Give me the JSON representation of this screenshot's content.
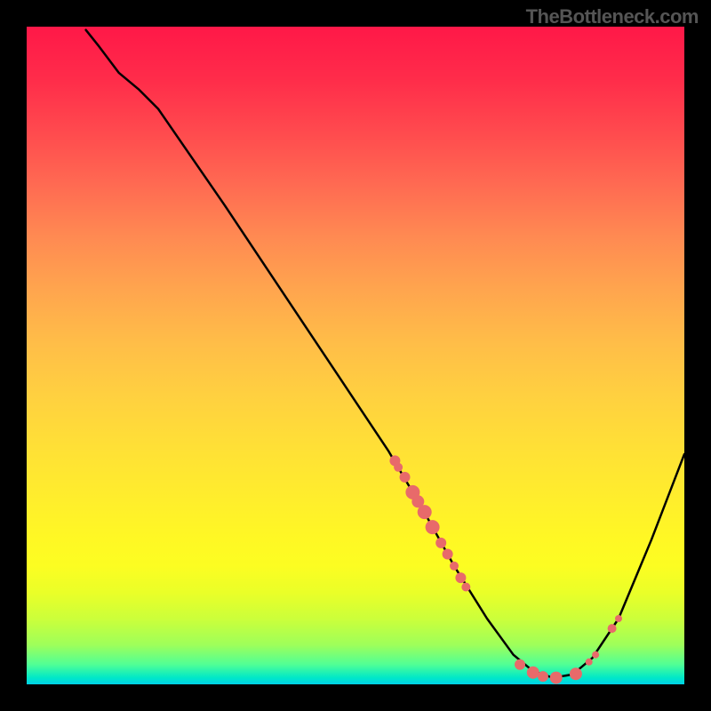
{
  "watermark": "TheBottleneck.com",
  "chart_data": {
    "type": "line",
    "title": "",
    "xlabel": "",
    "ylabel": "",
    "xlim": [
      0,
      100
    ],
    "ylim": [
      0,
      100
    ],
    "curve": [
      {
        "x": 9.0,
        "y": 99.5
      },
      {
        "x": 11.0,
        "y": 97.0
      },
      {
        "x": 14.0,
        "y": 93.0
      },
      {
        "x": 17.0,
        "y": 90.5
      },
      {
        "x": 20.0,
        "y": 87.5
      },
      {
        "x": 30.0,
        "y": 73.0
      },
      {
        "x": 40.0,
        "y": 58.0
      },
      {
        "x": 50.0,
        "y": 43.0
      },
      {
        "x": 55.0,
        "y": 35.5
      },
      {
        "x": 60.0,
        "y": 27.0
      },
      {
        "x": 65.0,
        "y": 18.0
      },
      {
        "x": 70.0,
        "y": 10.0
      },
      {
        "x": 74.0,
        "y": 4.5
      },
      {
        "x": 77.0,
        "y": 2.0
      },
      {
        "x": 80.0,
        "y": 1.0
      },
      {
        "x": 83.0,
        "y": 1.5
      },
      {
        "x": 86.0,
        "y": 4.0
      },
      {
        "x": 90.0,
        "y": 10.0
      },
      {
        "x": 95.0,
        "y": 22.0
      },
      {
        "x": 100.0,
        "y": 35.0
      }
    ],
    "highlight_dots": [
      {
        "x": 56.0,
        "y": 34.0,
        "r": 6
      },
      {
        "x": 56.5,
        "y": 33.0,
        "r": 5
      },
      {
        "x": 57.5,
        "y": 31.5,
        "r": 6
      },
      {
        "x": 58.7,
        "y": 29.2,
        "r": 8
      },
      {
        "x": 59.5,
        "y": 27.8,
        "r": 7
      },
      {
        "x": 60.5,
        "y": 26.2,
        "r": 8
      },
      {
        "x": 61.7,
        "y": 23.9,
        "r": 8
      },
      {
        "x": 63.0,
        "y": 21.5,
        "r": 6
      },
      {
        "x": 64.0,
        "y": 19.8,
        "r": 6
      },
      {
        "x": 65.0,
        "y": 18.0,
        "r": 5
      },
      {
        "x": 66.0,
        "y": 16.2,
        "r": 6
      },
      {
        "x": 66.8,
        "y": 14.8,
        "r": 5
      },
      {
        "x": 75.0,
        "y": 3.0,
        "r": 6
      },
      {
        "x": 77.0,
        "y": 1.8,
        "r": 7
      },
      {
        "x": 78.5,
        "y": 1.2,
        "r": 6
      },
      {
        "x": 80.5,
        "y": 1.0,
        "r": 7
      },
      {
        "x": 83.5,
        "y": 1.6,
        "r": 7
      },
      {
        "x": 85.5,
        "y": 3.4,
        "r": 4
      },
      {
        "x": 86.5,
        "y": 4.5,
        "r": 4
      },
      {
        "x": 89.0,
        "y": 8.5,
        "r": 5
      },
      {
        "x": 90.0,
        "y": 10.0,
        "r": 4
      }
    ]
  }
}
